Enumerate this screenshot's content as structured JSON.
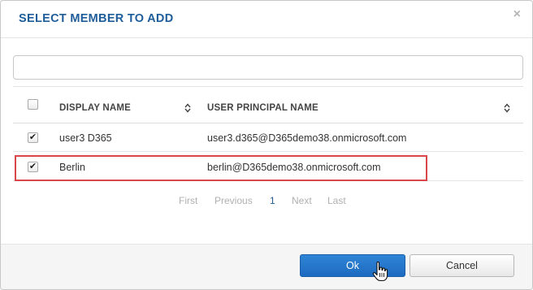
{
  "dialog": {
    "title": "SELECT MEMBER TO ADD",
    "close_glyph": "×"
  },
  "search": {
    "value": "",
    "placeholder": ""
  },
  "table": {
    "columns": [
      {
        "label": "DISPLAY NAME",
        "sortable": true
      },
      {
        "label": "USER PRINCIPAL NAME",
        "sortable": true
      }
    ],
    "select_all_checked": false,
    "rows": [
      {
        "checked": true,
        "check_glyph": "✔",
        "display_name": "user3 D365",
        "upn": "user3.d365@D365demo38.onmicrosoft.com"
      },
      {
        "checked": true,
        "check_glyph": "✔",
        "display_name": "Berlin",
        "upn": "berlin@D365demo38.onmicrosoft.com"
      }
    ],
    "highlighted_row": 1,
    "highlight_color": "#d9474b"
  },
  "pager": {
    "first": "First",
    "previous": "Previous",
    "current": "1",
    "next": "Next",
    "last": "Last"
  },
  "footer": {
    "ok_label": "Ok",
    "cancel_label": "Cancel"
  },
  "colors": {
    "title": "#1f5d9a",
    "primary": "#1d6bc0"
  },
  "icons": {
    "sort": "sort-icon",
    "close": "close-icon",
    "cursor": "hand-pointer-icon"
  }
}
